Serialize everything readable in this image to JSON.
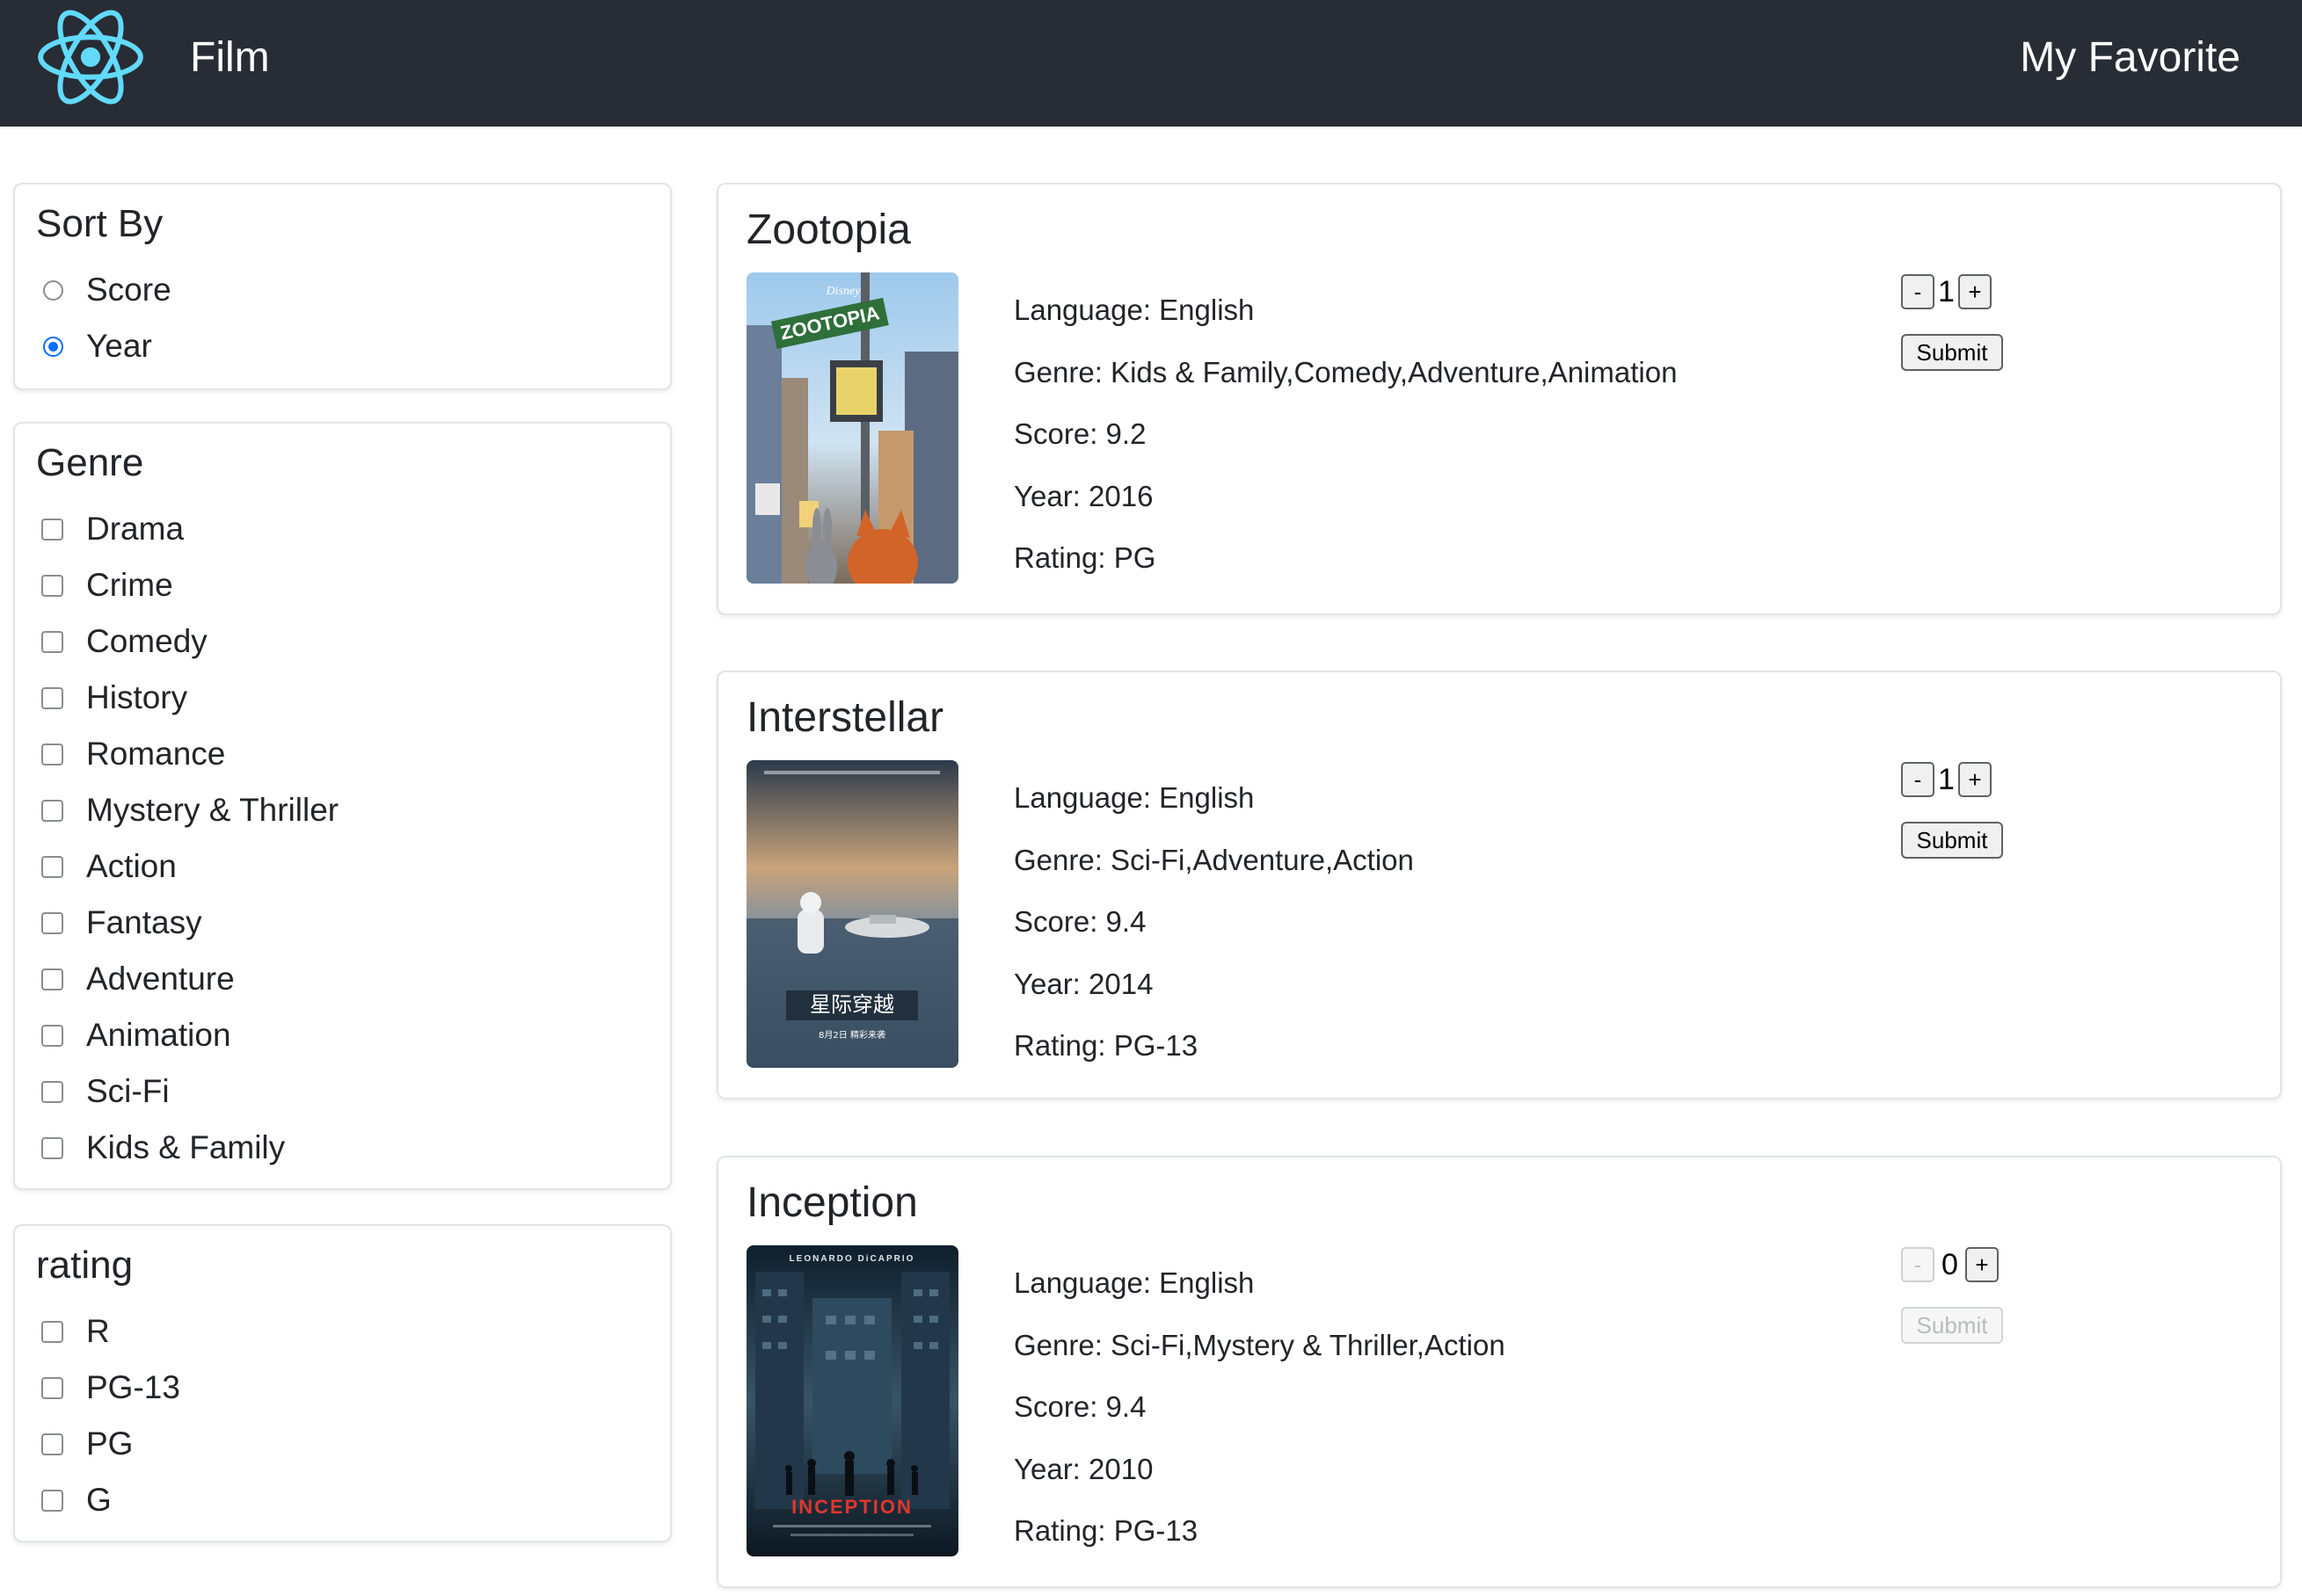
{
  "header": {
    "brand": "Film",
    "favorite_link": "My Favorite",
    "logo_icon": "react-atom-icon",
    "colors": {
      "background": "#282c34",
      "logo": "#61dafb",
      "text": "#ffffff"
    }
  },
  "sidebar": {
    "sort": {
      "title": "Sort By",
      "options": [
        {
          "label": "Score",
          "checked": false
        },
        {
          "label": "Year",
          "checked": true
        }
      ]
    },
    "genre": {
      "title": "Genre",
      "options": [
        {
          "label": "Drama",
          "checked": false
        },
        {
          "label": "Crime",
          "checked": false
        },
        {
          "label": "Comedy",
          "checked": false
        },
        {
          "label": "History",
          "checked": false
        },
        {
          "label": "Romance",
          "checked": false
        },
        {
          "label": "Mystery & Thriller",
          "checked": false
        },
        {
          "label": "Action",
          "checked": false
        },
        {
          "label": "Fantasy",
          "checked": false
        },
        {
          "label": "Adventure",
          "checked": false
        },
        {
          "label": "Animation",
          "checked": false
        },
        {
          "label": "Sci-Fi",
          "checked": false
        },
        {
          "label": "Kids & Family",
          "checked": false
        }
      ]
    },
    "rating": {
      "title": "rating",
      "options": [
        {
          "label": "R",
          "checked": false
        },
        {
          "label": "PG-13",
          "checked": false
        },
        {
          "label": "PG",
          "checked": false
        },
        {
          "label": "G",
          "checked": false
        }
      ]
    }
  },
  "movies": [
    {
      "title": "Zootopia",
      "language": "Language: English",
      "genre": "Genre: Kids & Family,Comedy,Adventure,Animation",
      "score": "Score: 9.2",
      "year": "Year: 2016",
      "rating": "Rating: PG",
      "count": "1",
      "minus": "-",
      "plus": "+",
      "submit": "Submit",
      "poster_text": "ZOOTOPIA",
      "poster_studio": "Disney",
      "controls_enabled": true
    },
    {
      "title": "Interstellar",
      "language": "Language: English",
      "genre": "Genre: Sci-Fi,Adventure,Action",
      "score": "Score: 9.4",
      "year": "Year: 2014",
      "rating": "Rating: PG-13",
      "count": "1",
      "minus": "-",
      "plus": "+",
      "submit": "Submit",
      "poster_text": "星际穿越",
      "poster_date": "8月2日 精彩来袭",
      "controls_enabled": true
    },
    {
      "title": "Inception",
      "language": "Language: English",
      "genre": "Genre: Sci-Fi,Mystery & Thriller,Action",
      "score": "Score: 9.4",
      "year": "Year: 2010",
      "rating": "Rating: PG-13",
      "count": "0",
      "minus": "-",
      "plus": "+",
      "submit": "Submit",
      "poster_text": "INCEPTION",
      "poster_top": "LEONARDO DiCAPRIO",
      "controls_enabled": false
    }
  ]
}
